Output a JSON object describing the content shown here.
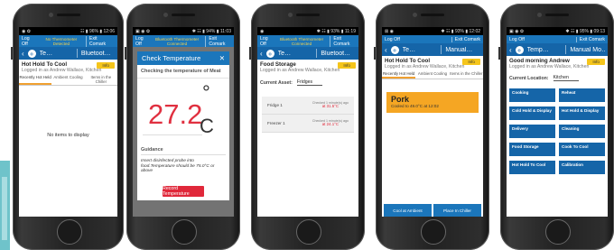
{
  "phone1": {
    "status_left": "◉ ✿",
    "status_right": "☷ ▮ 96% ▮ 12:06",
    "logoff": "Log Off",
    "probe_status": "No Thermometer Detected",
    "exit": "Exit Comark",
    "nav_title": "Te…",
    "nav_title2": "Bluetoot…",
    "title": "Hot Hold To Cool",
    "subtitle": "Logged in as Andrew Wallace, Kitchen",
    "info": "Info",
    "tabs": [
      "Recently Hot Held",
      "Ambient Cooling",
      "Items in the Chiller"
    ],
    "empty_text": "No items to display"
  },
  "phone2": {
    "status_left": "▣ ◉ ✿",
    "status_right": "✱ ☷ ▮ 94% ▮ 11:03",
    "logoff": "Log Off",
    "probe_status": "Bluetooth Thermometer Connected",
    "exit": "Exit Comark",
    "dialog_title": "Check Temperature",
    "close": "✕",
    "checking": "Checking the temperature of Meat",
    "temperature": "27.2",
    "degree": "°",
    "unit": "C",
    "guidance_label": "Guidance",
    "guidance_text": "Insert disinfected probe into food.Temperature should be 75.0°C or above",
    "record_button": "Record Temperature"
  },
  "phone3": {
    "status_left": "◉",
    "status_right": "✱ ☷ ▮ 93% ▮ 11:19",
    "logoff": "Log Off",
    "probe_status": "Bluetooth Thermometer Connected",
    "exit": "Exit Comark",
    "nav_title": "Te…",
    "nav_title2": "Bluetoot…",
    "title": "Food Storage",
    "subtitle": "Logged in as Andrew Wallace, Kitchen",
    "info": "Info",
    "asset_label": "Current Asset:",
    "asset_value": "Fridges",
    "assets": [
      {
        "name": "Fridge 1",
        "when": "Checked 1 minute(s) ago",
        "temp": "at 31.5°C"
      },
      {
        "name": "Freezer 1",
        "when": "Checked 1 minute(s) ago",
        "temp": "at 24.1°C"
      }
    ]
  },
  "phone4": {
    "status_left": "⊠ ◉",
    "status_right": "✱ ☷ ▮ 93% ▮ 12:02",
    "logoff": "Log Off",
    "exit": "Exit Comark",
    "nav_title": "Te…",
    "nav_title2": "Manual…",
    "title": "Hot Hold To Cool",
    "subtitle": "Logged in as Andrew Wallace, Kitchen",
    "info": "Info",
    "tabs": [
      "Recently Hot Held",
      "Ambient Cooling",
      "Items in the Chiller"
    ],
    "item_name": "Pork",
    "item_detail": "Cooled to 49.0°C at 12:02",
    "btn_ambient": "Cool at Ambient",
    "btn_chiller": "Place In Chiller"
  },
  "phone5": {
    "status_left": "▣ ◉ ✿",
    "status_right": "✱ ☷ ▮ 95% ▮ 09:13",
    "logoff": "Log Off",
    "exit": "Exit Comark",
    "nav_title": "Temp…",
    "nav_title2": "Manual Mo…",
    "greeting": "Good morning Andrew",
    "subtitle": "Logged in as Andrew Wallace, Kitchen",
    "info": "Info",
    "location_label": "Current Location:",
    "location_value": "Kitchen",
    "tasks": [
      "Cooking",
      "Reheat",
      "Cold Hold & Display",
      "Hot Hold & Display",
      "Delivery",
      "Cleaning",
      "Food Storage",
      "Cook To Cool",
      "Hot Hold To Cool",
      "Calibration"
    ]
  }
}
